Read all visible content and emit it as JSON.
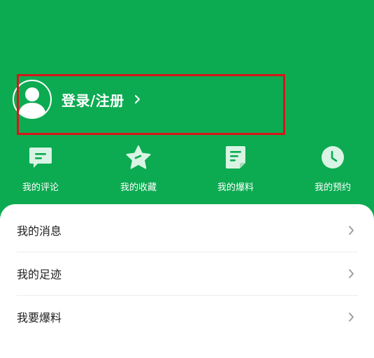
{
  "header": {
    "login_label": "登录/注册",
    "bg_color": "#0cab51",
    "avatar_icon": "user-avatar-icon",
    "chevron_icon": "chevron-right-icon"
  },
  "highlight": {
    "color": "#d8141a"
  },
  "quick_actions": [
    {
      "label": "我的评论",
      "icon": "comment-icon"
    },
    {
      "label": "我的收藏",
      "icon": "star-icon"
    },
    {
      "label": "我的爆料",
      "icon": "document-icon"
    },
    {
      "label": "我的预约",
      "icon": "clock-icon"
    }
  ],
  "menu": {
    "items": [
      {
        "label": "我的消息",
        "icon": "chevron-right-icon"
      },
      {
        "label": "我的足迹",
        "icon": "chevron-right-icon"
      },
      {
        "label": "我要爆料",
        "icon": "chevron-right-icon"
      }
    ]
  }
}
